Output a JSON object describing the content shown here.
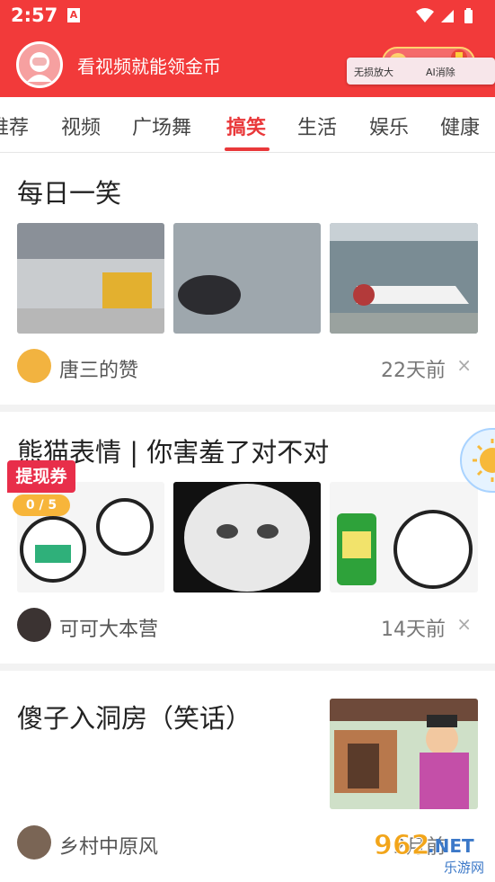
{
  "status_bar": {
    "time": "2:57",
    "sim_icon": "A"
  },
  "header": {
    "title": "看视频就能领金币"
  },
  "promo": {
    "left_text": "无损放大",
    "right_text": "AI消除"
  },
  "tabs": [
    {
      "label": "推荐"
    },
    {
      "label": "视频"
    },
    {
      "label": "广场舞"
    },
    {
      "label": "搞笑"
    },
    {
      "label": "生活"
    },
    {
      "label": "娱乐"
    },
    {
      "label": "健康"
    }
  ],
  "active_tab": "搞笑",
  "posts": [
    {
      "title": "每日一笑",
      "author": "唐三的赞",
      "time": "22天前",
      "close": "×"
    },
    {
      "title": "熊猫表情 | 你害羞了对不对",
      "author": "可可大本营",
      "time": "14天前",
      "close": "×"
    },
    {
      "title": "傻子入洞房（笑话）",
      "author": "乡村中原风",
      "time": "2月前",
      "close": "×"
    }
  ],
  "reward_tag": {
    "label": "提现券",
    "progress": "0 / 5"
  },
  "watermark": {
    "brand": "962.NET",
    "sub": "乐游网"
  },
  "colors": {
    "brand_red": "#f23a3a",
    "active_tab": "#e9383a",
    "reward_pink": "#e82e4a",
    "reward_gold": "#f7b53a"
  }
}
